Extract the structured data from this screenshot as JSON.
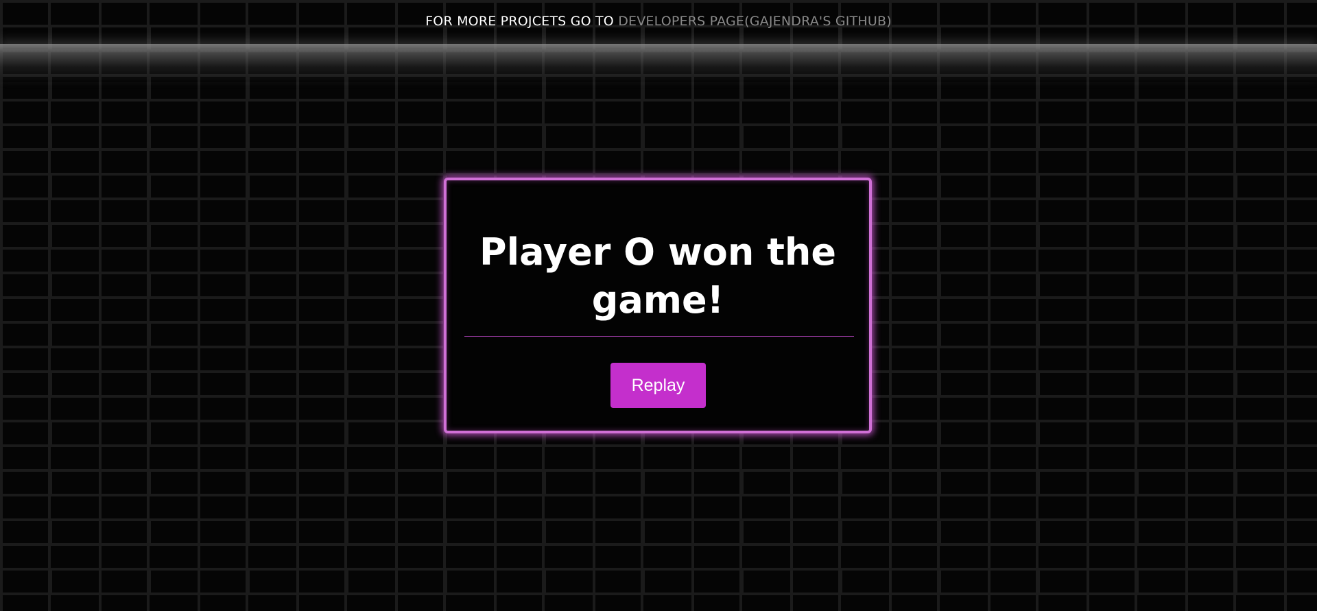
{
  "header": {
    "prefix_text": "FOR MORE PROJCETS GO TO",
    "link_text": "DEVELOPERS PAGE(GAJENDRA'S GITHUB)"
  },
  "modal": {
    "message": "Player O won the game!",
    "replay_label": "Replay"
  },
  "colors": {
    "accent": "#c42fcc",
    "border_glow": "#d070d6",
    "background": "#050505",
    "link": "#8a8a8a"
  }
}
